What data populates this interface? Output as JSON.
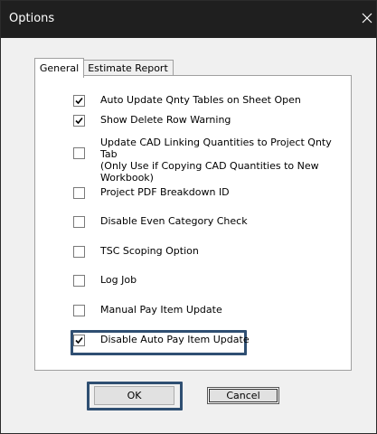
{
  "window": {
    "title": "Options",
    "close_glyph": "close-icon"
  },
  "tabs": [
    {
      "label": "General",
      "active": true
    },
    {
      "label": "Estimate Report",
      "active": false
    }
  ],
  "options": [
    {
      "label": "Auto Update Qnty Tables on Sheet Open",
      "checked": true
    },
    {
      "label": "Show Delete Row Warning",
      "checked": true
    },
    {
      "label": "Update CAD Linking Quantities to Project Qnty Tab\n(Only Use if Copying CAD Quantities to New\nWorkbook)",
      "checked": false
    },
    {
      "label": "Project PDF Breakdown ID",
      "checked": false
    },
    {
      "label": "Disable Even Category Check",
      "checked": false
    },
    {
      "label": "TSC Scoping Option",
      "checked": false
    },
    {
      "label": "Log Job",
      "checked": false
    },
    {
      "label": "Manual Pay Item Update",
      "checked": false
    },
    {
      "label": "Disable Auto Pay Item Update",
      "checked": true
    }
  ],
  "buttons": {
    "ok": "OK",
    "cancel": "Cancel"
  },
  "colors": {
    "titlebar": "#1f1f1f",
    "highlight": "#2f4f72",
    "dialog_bg": "#f0f0f0"
  }
}
